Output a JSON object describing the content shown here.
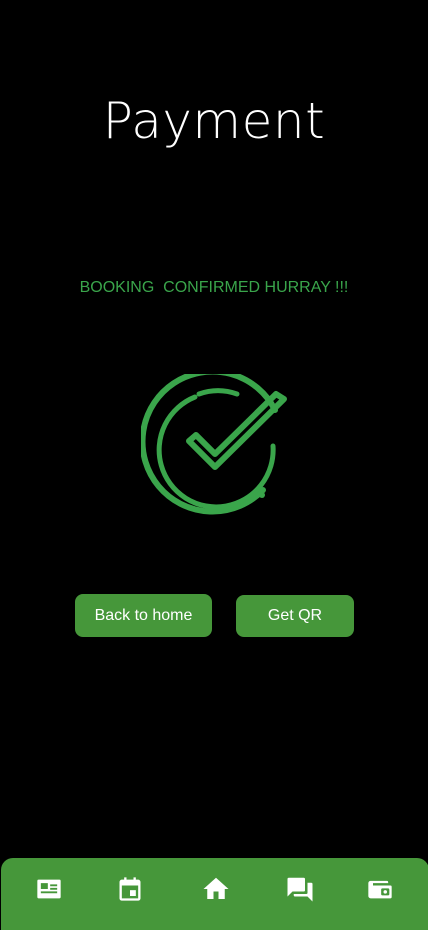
{
  "header": {
    "title": "Payment"
  },
  "status": {
    "message": "BOOKING  CONFIRMED HURRAY !!!",
    "icon": "check-circle-icon"
  },
  "actions": {
    "back_home_label": "Back to home",
    "get_qr_label": "Get QR"
  },
  "bottom_nav": {
    "items": [
      {
        "icon": "profile-card-icon"
      },
      {
        "icon": "calendar-icon"
      },
      {
        "icon": "home-icon"
      },
      {
        "icon": "chat-icon"
      },
      {
        "icon": "wallet-icon"
      }
    ]
  },
  "colors": {
    "background": "#000000",
    "accent_green": "#3aa54b",
    "button_green": "#46973a",
    "text": "#ffffff"
  }
}
